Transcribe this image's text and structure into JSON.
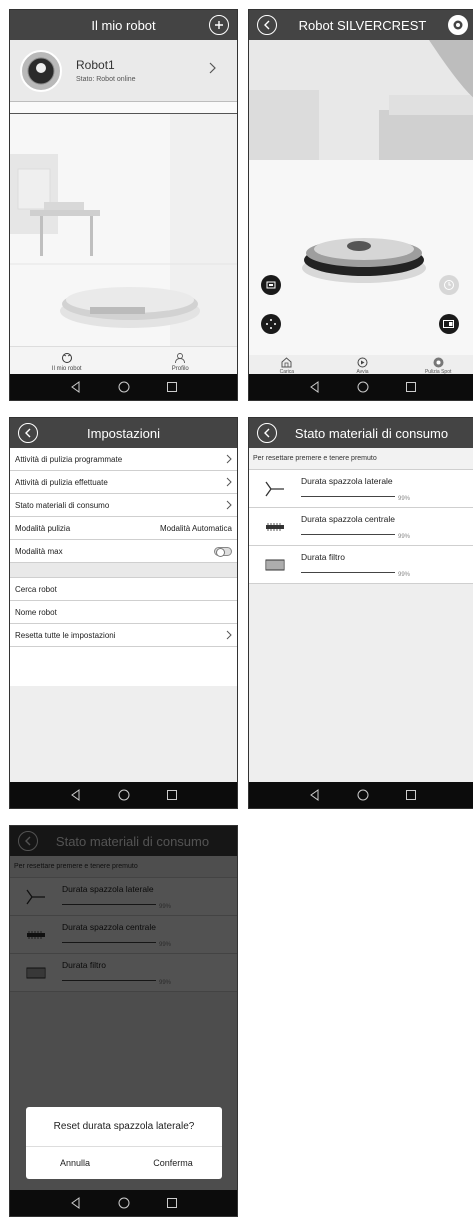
{
  "screen1": {
    "title": "Il mio robot",
    "robot_name": "Robot1",
    "robot_status": "Stato: Robot online",
    "tab_home": "Il mio robot",
    "tab_profile": "Profilo"
  },
  "screen2": {
    "title": "Robot SILVERCREST",
    "tab_charge": "Carica",
    "tab_start": "Avvia",
    "tab_spot": "Pulizia Spot"
  },
  "screen3": {
    "title": "Impostazioni",
    "rows": [
      "Attività di pulizia programmate",
      "Attività di pulizia effettuate",
      "Stato materiali di consumo"
    ],
    "mode_label": "Modalità pulizia",
    "mode_value": "Modalità Automatica",
    "max_label": "Modalità max",
    "search_robot": "Cerca robot",
    "robot_name": "Nome robot",
    "reset_all": "Resetta tutte le impostazioni"
  },
  "screen4": {
    "title": "Stato materiali di consumo",
    "hint": "Per resettare premere e tenere premuto",
    "items": [
      {
        "label": "Durata spazzola laterale",
        "pct": "99%",
        "icon": "side-brush-icon"
      },
      {
        "label": "Durata spazzola centrale",
        "pct": "99%",
        "icon": "main-brush-icon"
      },
      {
        "label": "Durata filtro",
        "pct": "99%",
        "icon": "filter-icon"
      }
    ]
  },
  "screen5": {
    "dialog_title": "Reset durata spazzola laterale?",
    "cancel": "Annulla",
    "confirm": "Conferma"
  }
}
